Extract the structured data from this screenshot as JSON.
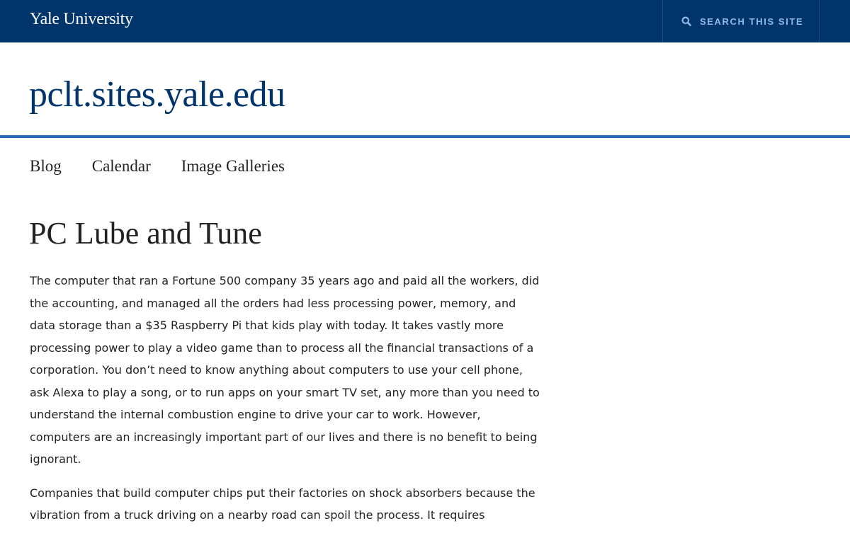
{
  "header": {
    "university_name": "Yale University",
    "search_label": "SEARCH THIS SITE"
  },
  "site": {
    "title": "pclt.sites.yale.edu"
  },
  "nav": {
    "items": [
      {
        "label": "Blog"
      },
      {
        "label": "Calendar"
      },
      {
        "label": "Image Galleries"
      }
    ]
  },
  "page": {
    "title": "PC Lube and Tune",
    "paragraphs": [
      "The computer that ran a Fortune 500 company 35 years ago and paid all the workers, did the accounting, and managed all the orders had less processing power, memory, and data storage than a $35 Raspberry Pi that kids play with today. It takes vastly more processing power to play a video game than to process all the financial transactions of a corporation. You don’t need to know anything about computers to use your cell phone, ask Alexa to play a song, or to run apps on your smart TV set, any more than you need to understand the internal combustion engine to drive your car to work. However, computers are an increasingly important part of our lives and there is no benefit to being ignorant.",
      "Companies that build computer chips put their factories on shock absorbers because the vibration from a truck driving on a nearby road can spoil the process. It requires"
    ]
  },
  "colors": {
    "header_bg": "#00356b",
    "accent_rule": "#286dc0",
    "search_text": "#8fb8e8",
    "site_title": "#00356b"
  },
  "icons": {
    "search": "search-icon"
  }
}
